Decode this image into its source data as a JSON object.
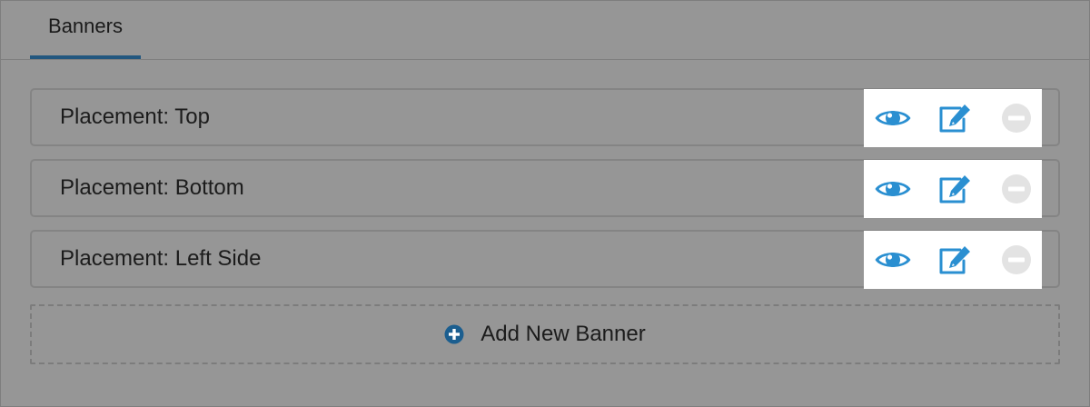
{
  "tabs": [
    {
      "label": "Banners",
      "active": true
    }
  ],
  "banners": [
    {
      "label": "Placement: Top"
    },
    {
      "label": "Placement: Bottom"
    },
    {
      "label": "Placement: Left Side"
    }
  ],
  "row_actions": {
    "icons": [
      "eye-icon",
      "edit-icon",
      "minus-circle-icon"
    ]
  },
  "add_button": {
    "label": "Add New Banner",
    "icon": "plus-circle-icon"
  },
  "colors": {
    "panel_bg": "#969696",
    "accent_blue": "#2a8fd1",
    "tab_underline": "#22577f",
    "plus_icon": "#1b5e8f",
    "remove_icon": "#e3e3e3",
    "actions_bg": "#ffffff"
  }
}
